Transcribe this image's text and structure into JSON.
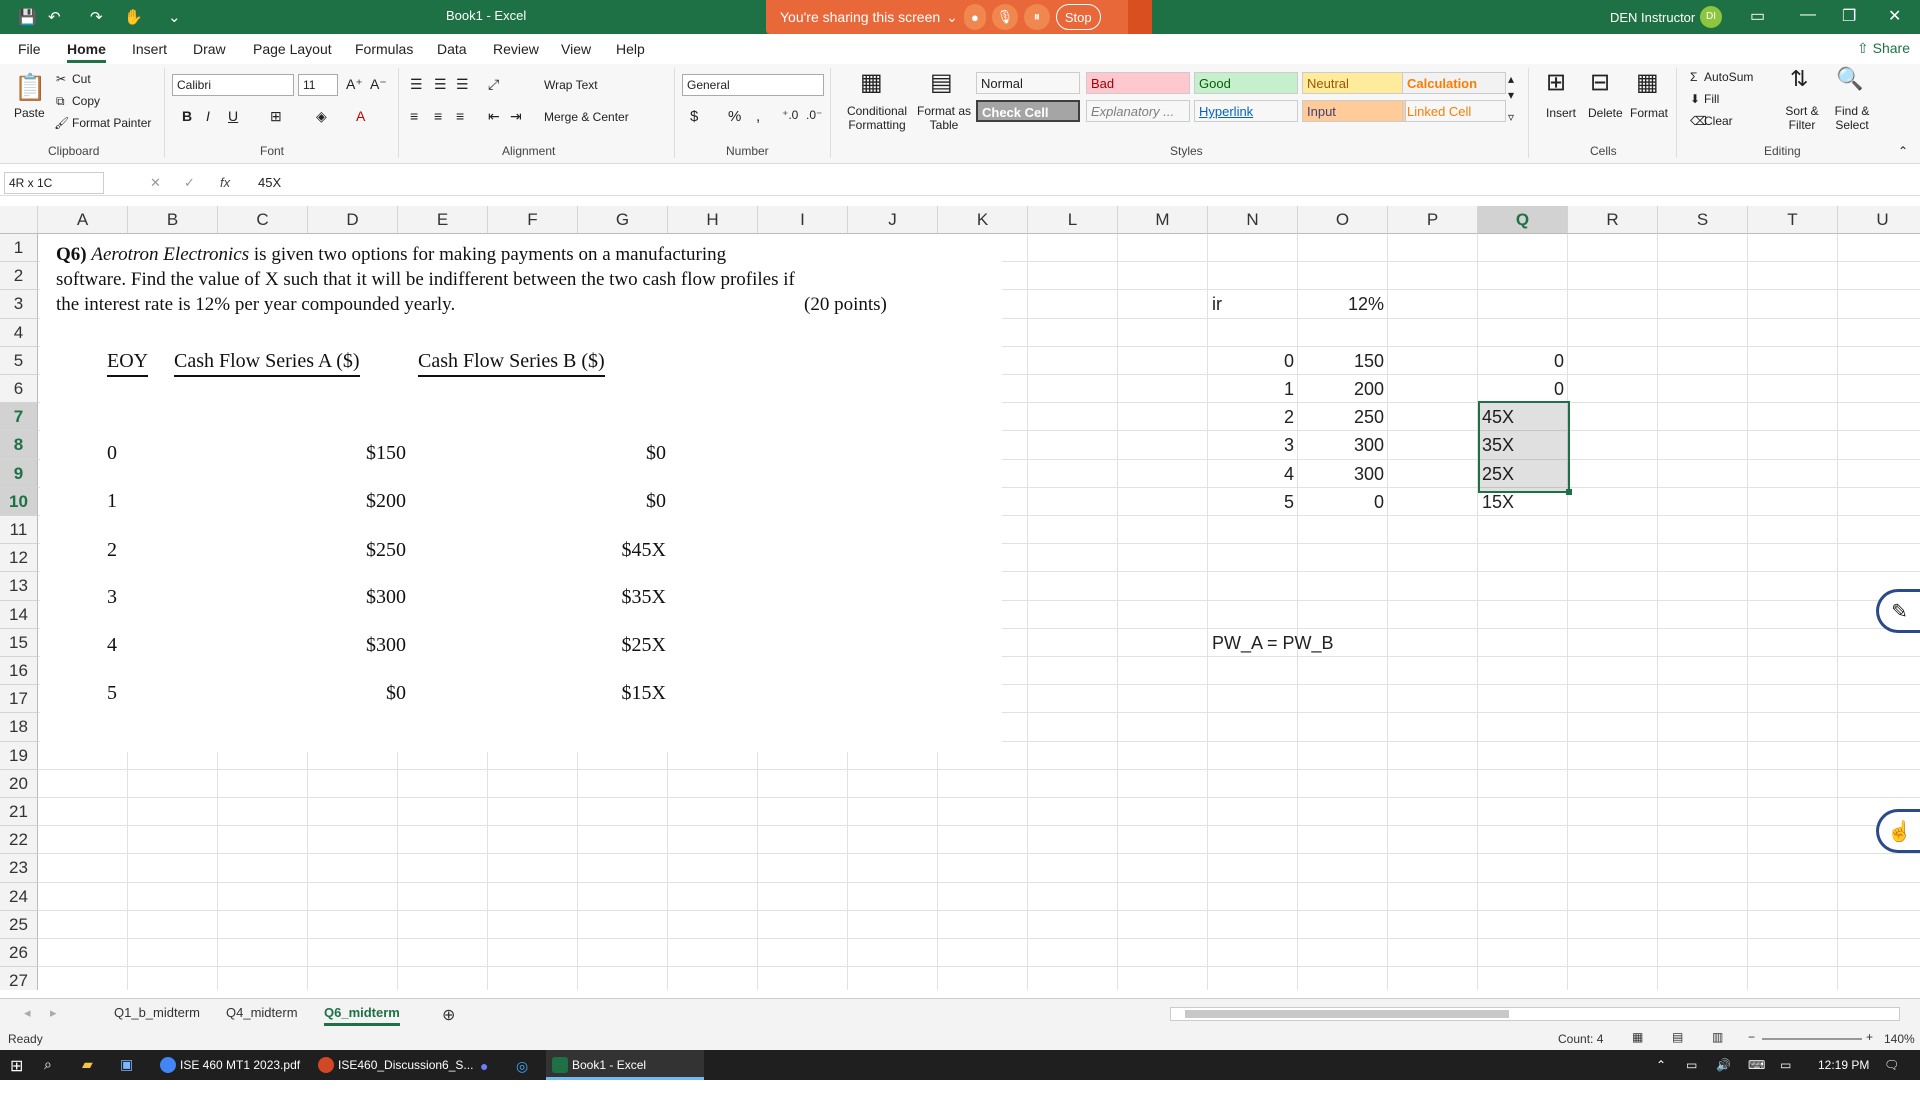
{
  "window": {
    "title": "Book1  -  Excel",
    "user": "DEN Instructor",
    "avatar_initials": "DI"
  },
  "share": {
    "text": "You're sharing this screen",
    "stop": "Stop"
  },
  "menu": [
    "File",
    "Home",
    "Insert",
    "Draw",
    "Page Layout",
    "Formulas",
    "Data",
    "Review",
    "View",
    "Help"
  ],
  "share_button": "Share",
  "ribbon": {
    "clipboard": {
      "label": "Clipboard",
      "paste": "Paste",
      "cut": "Cut",
      "copy": "Copy",
      "format_painter": "Format Painter"
    },
    "font": {
      "label": "Font",
      "name": "Calibri",
      "size": "11"
    },
    "alignment": {
      "label": "Alignment",
      "wrap": "Wrap Text",
      "merge": "Merge & Center"
    },
    "number": {
      "label": "Number",
      "format": "General"
    },
    "styles": {
      "label": "Styles",
      "conditional": "Conditional Formatting",
      "format_table": "Format as Table",
      "cells": [
        {
          "name": "Normal",
          "bg": "#ffffff",
          "fg": "#000000"
        },
        {
          "name": "Bad",
          "bg": "#ffc7ce",
          "fg": "#9c0006"
        },
        {
          "name": "Good",
          "bg": "#c6efce",
          "fg": "#006100"
        },
        {
          "name": "Neutral",
          "bg": "#ffeb9c",
          "fg": "#9c5700"
        },
        {
          "name": "Calculation",
          "bg": "#f2f2f2",
          "fg": "#fa7d00"
        },
        {
          "name": "Check Cell",
          "bg": "#a5a5a5",
          "fg": "#ffffff"
        },
        {
          "name": "Explanatory ...",
          "bg": "#ffffff",
          "fg": "#7f7f7f"
        },
        {
          "name": "Hyperlink",
          "bg": "#ffffff",
          "fg": "#0563c1"
        },
        {
          "name": "Input",
          "bg": "#ffcc99",
          "fg": "#3f3f76"
        },
        {
          "name": "Linked Cell",
          "bg": "#ffffff",
          "fg": "#fa7d00"
        }
      ]
    },
    "cells": {
      "label": "Cells",
      "insert": "Insert",
      "delete": "Delete",
      "format": "Format"
    },
    "editing": {
      "label": "Editing",
      "autosum": "AutoSum",
      "fill": "Fill",
      "clear": "Clear",
      "sort": "Sort & Filter",
      "find": "Find & Select"
    }
  },
  "formula_bar": {
    "name_box": "4R x 1C",
    "content": "45X"
  },
  "columns": [
    "A",
    "B",
    "C",
    "D",
    "E",
    "F",
    "G",
    "H",
    "I",
    "J",
    "K",
    "L",
    "M",
    "N",
    "O",
    "P",
    "Q",
    "R",
    "S",
    "T",
    "U"
  ],
  "rows": [
    "1",
    "2",
    "3",
    "4",
    "5",
    "6",
    "7",
    "8",
    "9",
    "10",
    "11",
    "12",
    "13",
    "14",
    "15",
    "16",
    "17",
    "18",
    "19",
    "20",
    "21",
    "22",
    "23",
    "24",
    "25",
    "26",
    "27"
  ],
  "question": {
    "label": "Q6)",
    "company": "Aerotron Electronics",
    "line1": "is given two options for making payments on a manufacturing",
    "line2": "software. Find the value of X such that it will be indifferent between the two cash flow profiles if",
    "line3": "the interest rate is 12% per year compounded yearly.",
    "points": "(20 points)",
    "headers": {
      "eoy": "EOY",
      "a": "Cash Flow Series A ($)",
      "b": "Cash Flow Series B ($)"
    },
    "table": [
      {
        "eoy": "0",
        "a": "$150",
        "b": "$0"
      },
      {
        "eoy": "1",
        "a": "$200",
        "b": "$0"
      },
      {
        "eoy": "2",
        "a": "$250",
        "b": "$45X"
      },
      {
        "eoy": "3",
        "a": "$300",
        "b": "$35X"
      },
      {
        "eoy": "4",
        "a": "$300",
        "b": "$25X"
      },
      {
        "eoy": "5",
        "a": "$0",
        "b": "$15X"
      }
    ]
  },
  "sheet": {
    "ir_label": "ir",
    "ir_value": "12%",
    "n_col": [
      "0",
      "1",
      "2",
      "3",
      "4",
      "5"
    ],
    "o_col": [
      "150",
      "200",
      "250",
      "300",
      "300",
      "0"
    ],
    "q_col": [
      "0",
      "0",
      "45X",
      "35X",
      "25X",
      "15X"
    ],
    "equation": "PW_A = PW_B"
  },
  "tabs": [
    "Q1_b_midterm",
    "Q4_midterm",
    "Q6_midterm"
  ],
  "status": {
    "ready": "Ready",
    "count": "Count: 4",
    "zoom": "140%"
  },
  "taskbar": {
    "items": [
      "ISE 460 MT1 2023.pdf ...",
      "ISE460_Discussion6_S...",
      "Book1 - Excel"
    ],
    "time": "12:19 PM"
  }
}
